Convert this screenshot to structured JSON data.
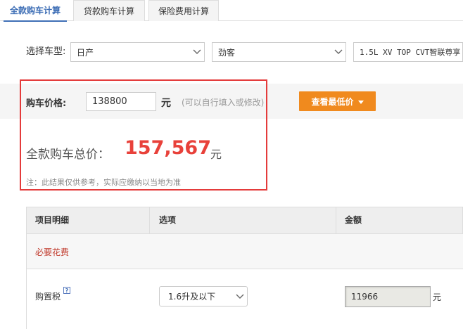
{
  "tabs": [
    {
      "label": "全款购车计算",
      "active": true
    },
    {
      "label": "贷款购车计算",
      "active": false
    },
    {
      "label": "保险费用计算",
      "active": false
    }
  ],
  "model_selector": {
    "label": "选择车型:",
    "brand": "日产",
    "series": "劲客",
    "trim": "1.5L XV TOP CVT智联尊享"
  },
  "price": {
    "label": "购车价格:",
    "value": "138800",
    "unit": "元",
    "hint": "(可以自行填入或修改)",
    "lowest_price_button": "查看最低价"
  },
  "total": {
    "label": "全款购车总价：",
    "value": "157,567",
    "unit": "元",
    "note": "注：此结果仅供参考，实际应缴纳以当地为准"
  },
  "table": {
    "headers": [
      "项目明细",
      "选项",
      "金额"
    ],
    "section_title": "必要花费",
    "rows": [
      {
        "item": "购置税",
        "help_icon": "?",
        "option": "1.6升及以下",
        "amount": "11966",
        "unit": "元"
      }
    ]
  },
  "colors": {
    "accent_blue": "#3f6fb6",
    "button_orange": "#f08a1e",
    "total_red": "#e8413a",
    "highlight_border": "#e43b3b",
    "section_red": "#c0392b"
  }
}
